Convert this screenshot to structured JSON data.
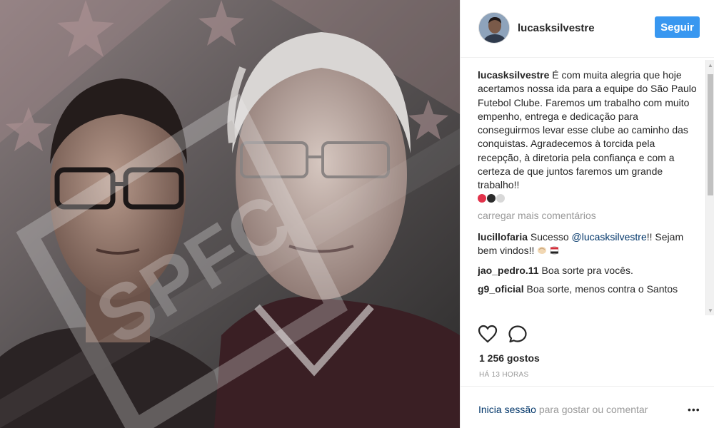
{
  "post": {
    "username": "lucasksilvestre",
    "follow_label": "Seguir",
    "caption": {
      "username": "lucasksilvestre",
      "text": "É com muita alegria que hoje acertamos nossa ida para a equipe do São Paulo Futebol Clube. Faremos um trabalho com muito empenho, entrega e dedicação para conseguirmos levar esse clube ao caminho das conquistas. Agradecemos à torcida pela recepção, à diretoria pela confiança e com a certeza de que juntos faremos um grande trabalho!!",
      "emoji_colors": [
        "#e2334b",
        "#2b2b2b",
        "#d8d8d8"
      ]
    },
    "load_more": "carregar mais comentários",
    "comments": [
      {
        "username": "lucillofaria",
        "text_before": "Sucesso",
        "mention": "@lucasksilvestre",
        "text_after": "!! Sejam bem vindos!! "
      },
      {
        "username": "jao_pedro.11",
        "text": "Boa sorte pra vocês."
      },
      {
        "username": "g9_oficial",
        "text": "Boa sorte, menos contra o Santos"
      }
    ],
    "likes": "1 256 gostos",
    "time": "HÁ 13 HORAS",
    "login_link": "Inicia sessão",
    "login_rest": " para gostar ou comentar",
    "watermark_text": "SPFC",
    "icons": [
      "heart-icon",
      "comment-icon",
      "more-options-icon"
    ]
  }
}
